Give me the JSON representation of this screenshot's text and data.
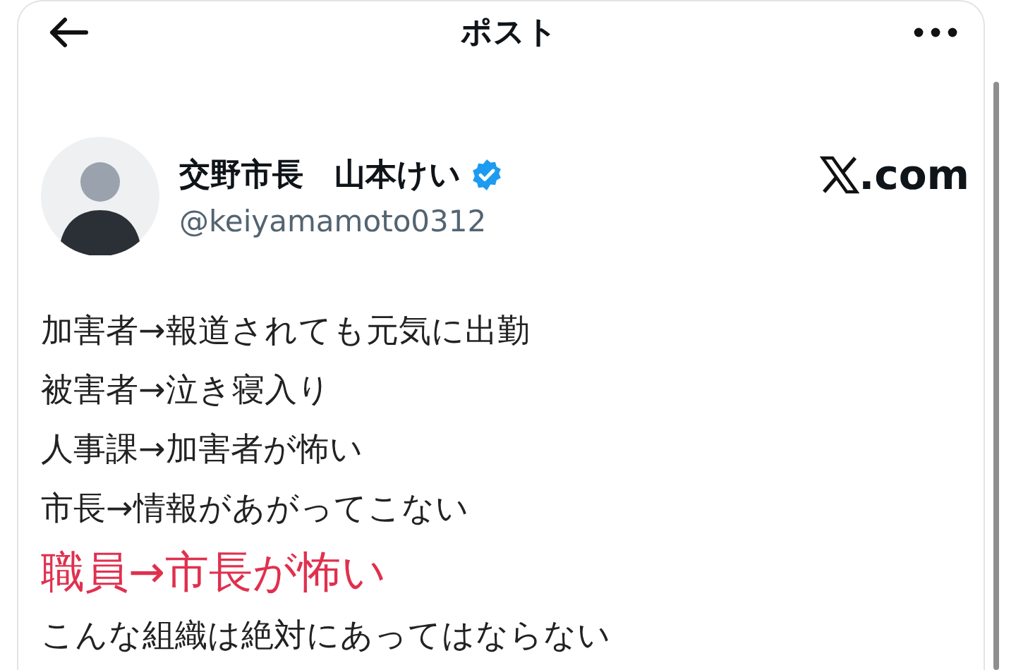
{
  "header": {
    "title": "ポスト"
  },
  "author": {
    "name": "交野市長　山本けい",
    "verified": true,
    "handle": "@keiyamamoto0312"
  },
  "site": {
    "suffix": ".com"
  },
  "post": {
    "lines": [
      {
        "text": "加害者→報道されても元気に出勤",
        "highlight": false
      },
      {
        "text": "被害者→泣き寝入り",
        "highlight": false
      },
      {
        "text": "人事課→加害者が怖い",
        "highlight": false
      },
      {
        "text": "市長→情報があがってこない",
        "highlight": false
      },
      {
        "text": "職員→市長が怖い",
        "highlight": true
      },
      {
        "text": "こんな組織は絶対にあってはならない",
        "highlight": false
      }
    ]
  }
}
